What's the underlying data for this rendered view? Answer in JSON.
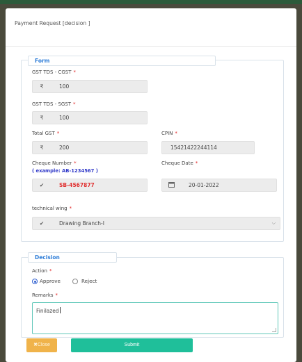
{
  "modal": {
    "title": "Payment Request [decision ]"
  },
  "form": {
    "legend": "Form",
    "gst_cgst": {
      "label": "GST TDS - CGST",
      "symbol": "₹",
      "value": "100"
    },
    "gst_sgst": {
      "label": "GST TDS - SGST",
      "symbol": "₹",
      "value": "100"
    },
    "total_gst": {
      "label": "Total GST",
      "symbol": "₹",
      "value": "200"
    },
    "cpin": {
      "label": "CPIN",
      "value": "15421422244114"
    },
    "cheque_number": {
      "label": "Cheque Number",
      "hint": "( example: AB-1234567 )",
      "value": "SB-4567877"
    },
    "cheque_date": {
      "label": "Cheque Date",
      "value": "20-01-2022"
    },
    "technical_wing": {
      "label": "technical wing",
      "value": "Drawing Branch-I"
    },
    "required_mark": "*"
  },
  "decision": {
    "legend": "Decision",
    "action_label": "Action",
    "options": [
      "Approve",
      "Reject"
    ],
    "selected": "Approve",
    "remarks_label": "Remarks",
    "remarks_value": "Finilazed"
  },
  "buttons": {
    "close": "✖Close",
    "submit": "Submit"
  }
}
